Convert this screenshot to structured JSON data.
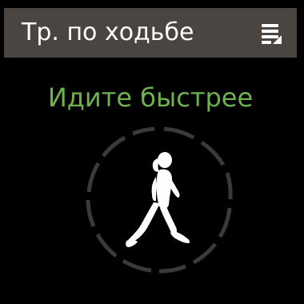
{
  "header": {
    "title": "Тр. по ходьбе",
    "menu_icon": "menu-icon"
  },
  "main": {
    "status_text": "Идите быстрее",
    "walker_icon": "walking-person-icon",
    "progress_ring_icon": "progress-ring-icon",
    "accent_color": "#6fb14f",
    "header_color": "#4a4541"
  }
}
